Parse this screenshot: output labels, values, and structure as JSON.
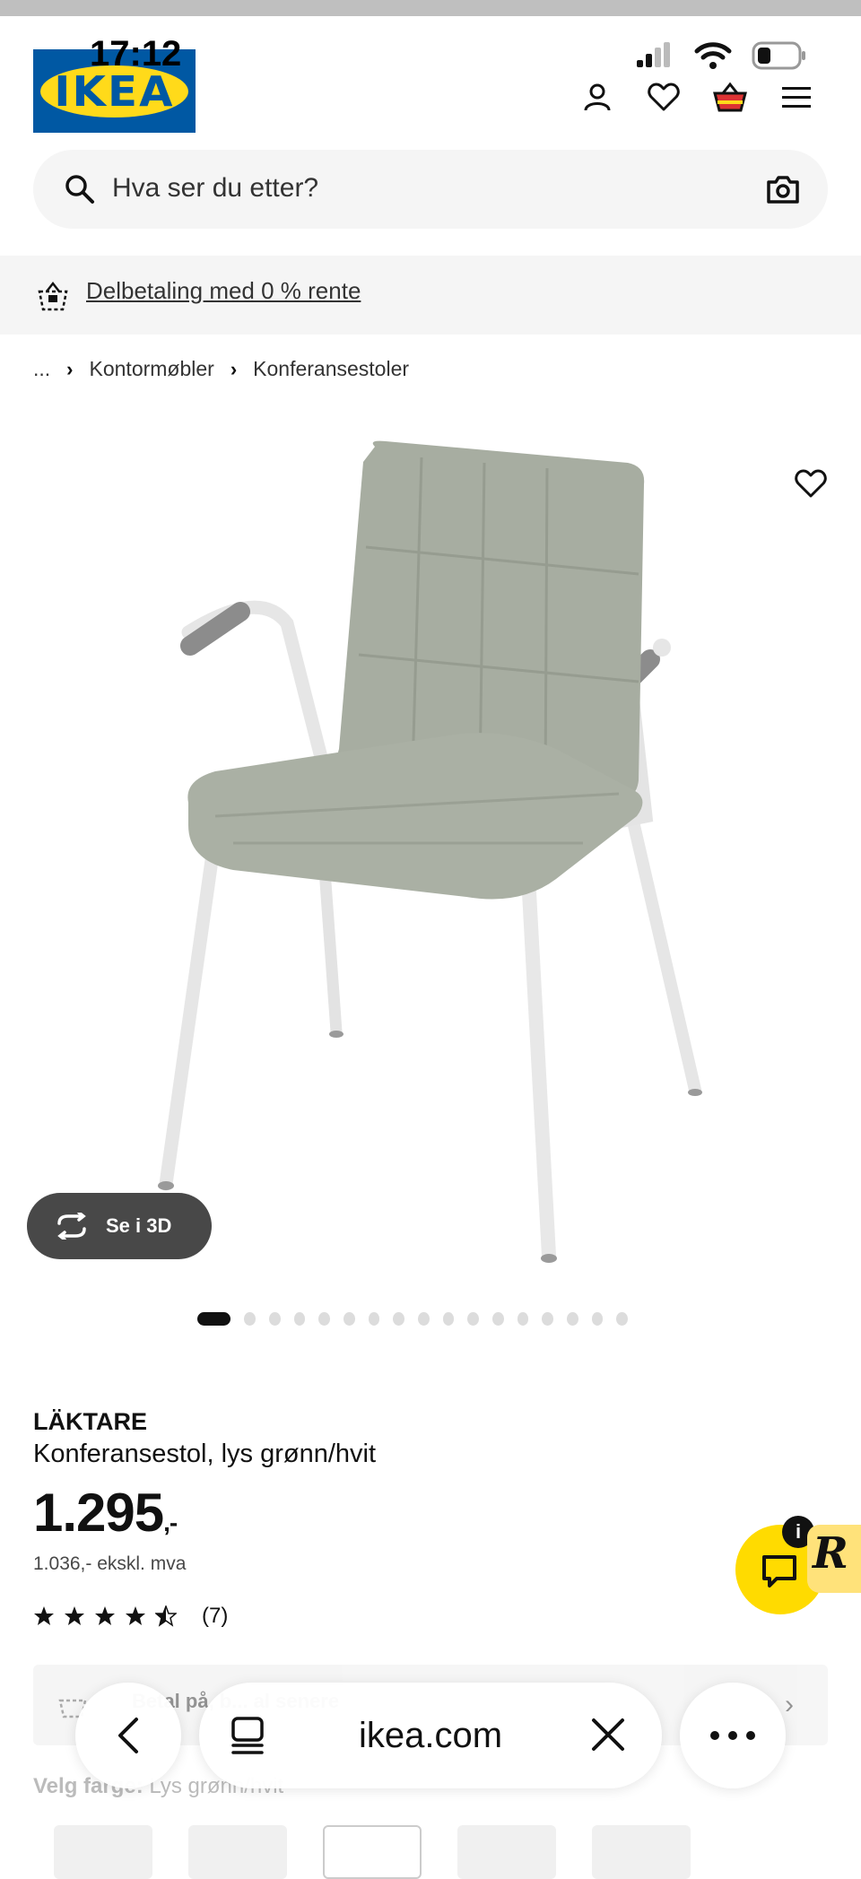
{
  "status": {
    "time": "17:12"
  },
  "header": {
    "logo_text": "IKEA",
    "icons": [
      "user-icon",
      "heart-icon",
      "basket-icon",
      "menu-icon"
    ]
  },
  "search": {
    "placeholder": "Hva ser du etter?"
  },
  "promo": {
    "text": "Delbetaling med 0 % rente"
  },
  "breadcrumb": {
    "items": [
      "...",
      "Kontormøbler",
      "Konferansestoler"
    ]
  },
  "gallery": {
    "view3d_label": "Se i 3D",
    "slide_count": 17,
    "active_slide": 1
  },
  "product": {
    "name": "LÄKTARE",
    "description": "Konferansestol, lys grønn/hvit",
    "price_main": "1.295",
    "price_suffix": ",-",
    "price_ex_vat": "1.036,- ekskl. mva",
    "rating": 4.5,
    "rating_max": 5,
    "review_count": "(7)"
  },
  "card": {
    "text": "Betal på, b... al senere"
  },
  "color": {
    "label": "Velg farge:",
    "value": "Lys grønn/hvit"
  },
  "chat": {
    "info": "i",
    "badge": "R"
  },
  "browser": {
    "url": "ikea.com"
  },
  "colors": {
    "ikea_blue": "#0058a3",
    "ikea_yellow": "#ffda1a",
    "chat_yellow": "#ffdb00"
  }
}
